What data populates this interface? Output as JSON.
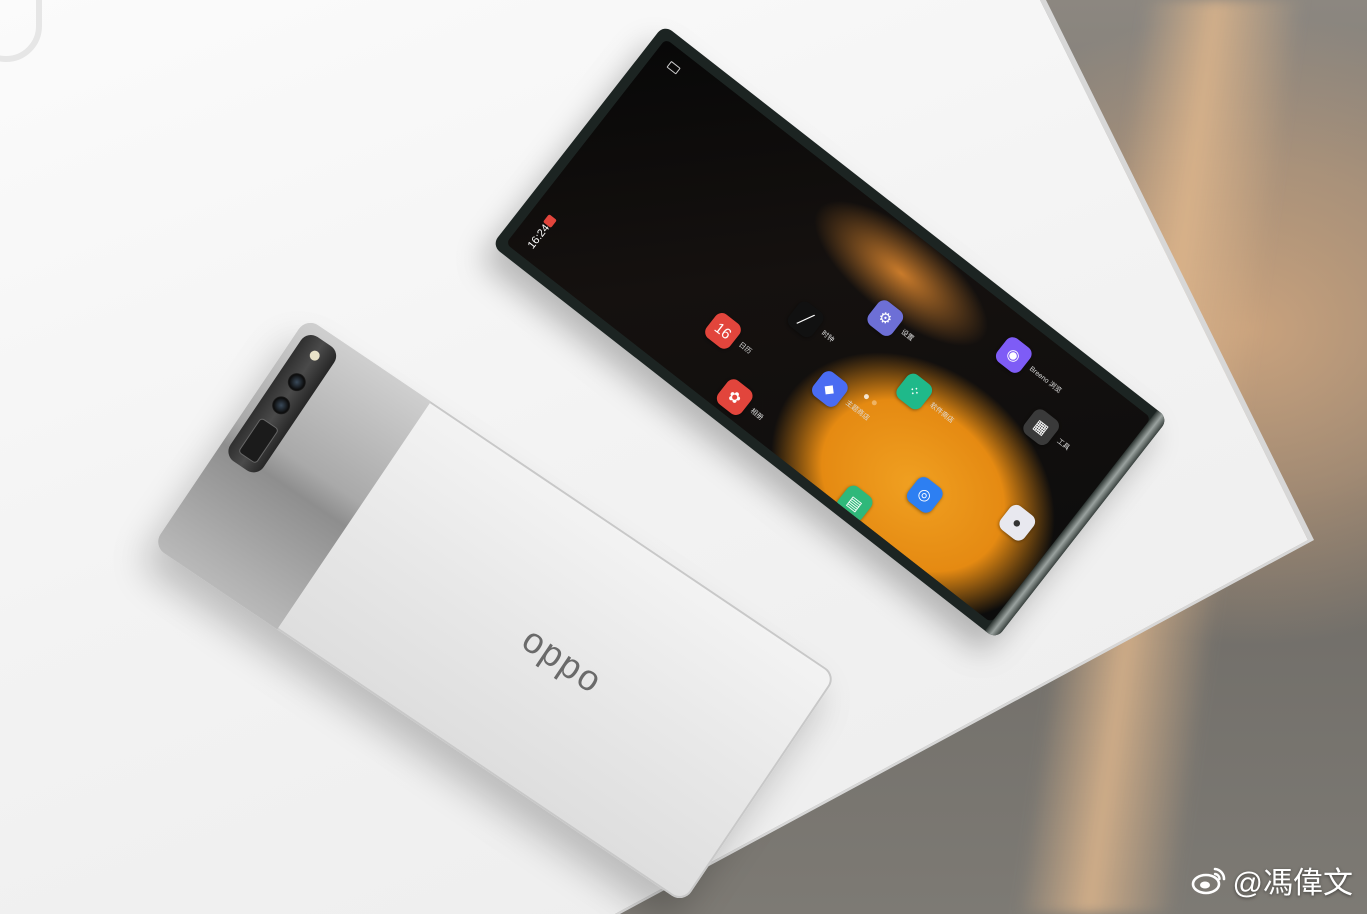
{
  "photo": {
    "subject": "rollable-phone-and-tablet",
    "background_color": "#6d6a66",
    "table_color": "#f3f3f3"
  },
  "tablet": {
    "status_time": "16:24",
    "apps": [
      {
        "icon": "browser-icon",
        "label": "Breeno 浏览",
        "color": "#7e5cf6"
      },
      {
        "icon": "settings-icon",
        "label": "设置",
        "color": "#6d6fd6"
      },
      {
        "icon": "tools-icon",
        "label": "工具",
        "color": "#3a3a3a"
      },
      {
        "icon": "contacts-icon",
        "label": "软件商店",
        "color": "#1fb98a"
      },
      {
        "icon": "camera-icon",
        "label": "",
        "color": "#e8e8ef"
      },
      {
        "icon": "clock-icon",
        "label": "时钟",
        "color": "#111111"
      },
      {
        "icon": "theme-icon",
        "label": "主题商店",
        "color": "#4a6cf2"
      },
      {
        "icon": "compass-icon",
        "label": "",
        "color": "#2d7ff2"
      },
      {
        "icon": "calendar-icon",
        "label": "日历",
        "color": "#e2453c",
        "value": "16"
      },
      {
        "icon": "photos-icon",
        "label": "相册",
        "color": "#e2453c"
      },
      {
        "icon": "notes-icon",
        "label": "",
        "color": "#2fb87a"
      },
      {
        "icon": "phone-icon",
        "label": "",
        "color": "#22b573"
      }
    ]
  },
  "phone": {
    "logo": "oppo"
  },
  "watermark": {
    "text": "@馮偉文"
  }
}
